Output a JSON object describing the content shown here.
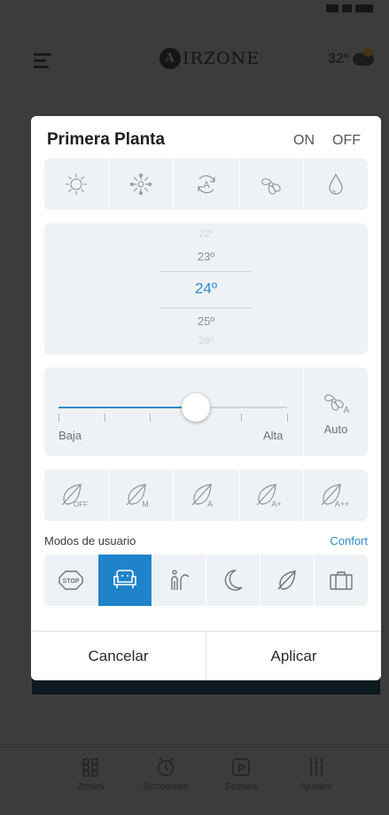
{
  "app": {
    "logo_letter": "A",
    "logo_text": "IRZONE",
    "temperature": "32º"
  },
  "modal": {
    "zone_title": "Primera Planta",
    "on_label": "ON",
    "off_label": "OFF",
    "modes": [
      "sun-icon",
      "snowflake-icon",
      "auto-mode-icon",
      "fan-icon",
      "drop-icon"
    ],
    "temperatures": {
      "far_above": "22º",
      "above": "23º",
      "selected": "24º",
      "below": "25º",
      "far_below": "26º"
    },
    "fan_speed": {
      "low_label": "Baja",
      "high_label": "Alta",
      "auto_label": "Auto",
      "auto_icon_letter": "A",
      "level_fraction": 0.6,
      "ticks": 6
    },
    "eco_modes": [
      {
        "icon": "leaf-off-icon",
        "label": "OFF"
      },
      {
        "icon": "leaf-m-icon",
        "label": "M"
      },
      {
        "icon": "leaf-a-icon",
        "label": "A"
      },
      {
        "icon": "leaf-a-plus-icon",
        "label": "A+"
      },
      {
        "icon": "leaf-a-plus-plus-icon",
        "label": "A++"
      }
    ],
    "user_modes_label": "Modos de usuario",
    "user_modes_value": "Confort",
    "user_modes": [
      {
        "icon": "stop-icon",
        "label": "STOP",
        "active": false
      },
      {
        "icon": "armchair-icon",
        "active": true
      },
      {
        "icon": "people-icon",
        "active": false
      },
      {
        "icon": "moon-icon",
        "active": false
      },
      {
        "icon": "leaf-icon",
        "active": false
      },
      {
        "icon": "suitcase-icon",
        "active": false
      }
    ],
    "cancel_label": "Cancelar",
    "apply_label": "Aplicar"
  },
  "nav": [
    {
      "icon": "grid-icon",
      "label": "Zones"
    },
    {
      "icon": "alarm-clock-icon",
      "label": "Schedules"
    },
    {
      "icon": "play-icon",
      "label": "Scenes"
    },
    {
      "icon": "sliders-icon",
      "label": "Ajustes"
    }
  ],
  "colors": {
    "accent": "#2b8bd0",
    "active_mode": "#1f83c9",
    "panel_bg": "#eef2f5"
  }
}
